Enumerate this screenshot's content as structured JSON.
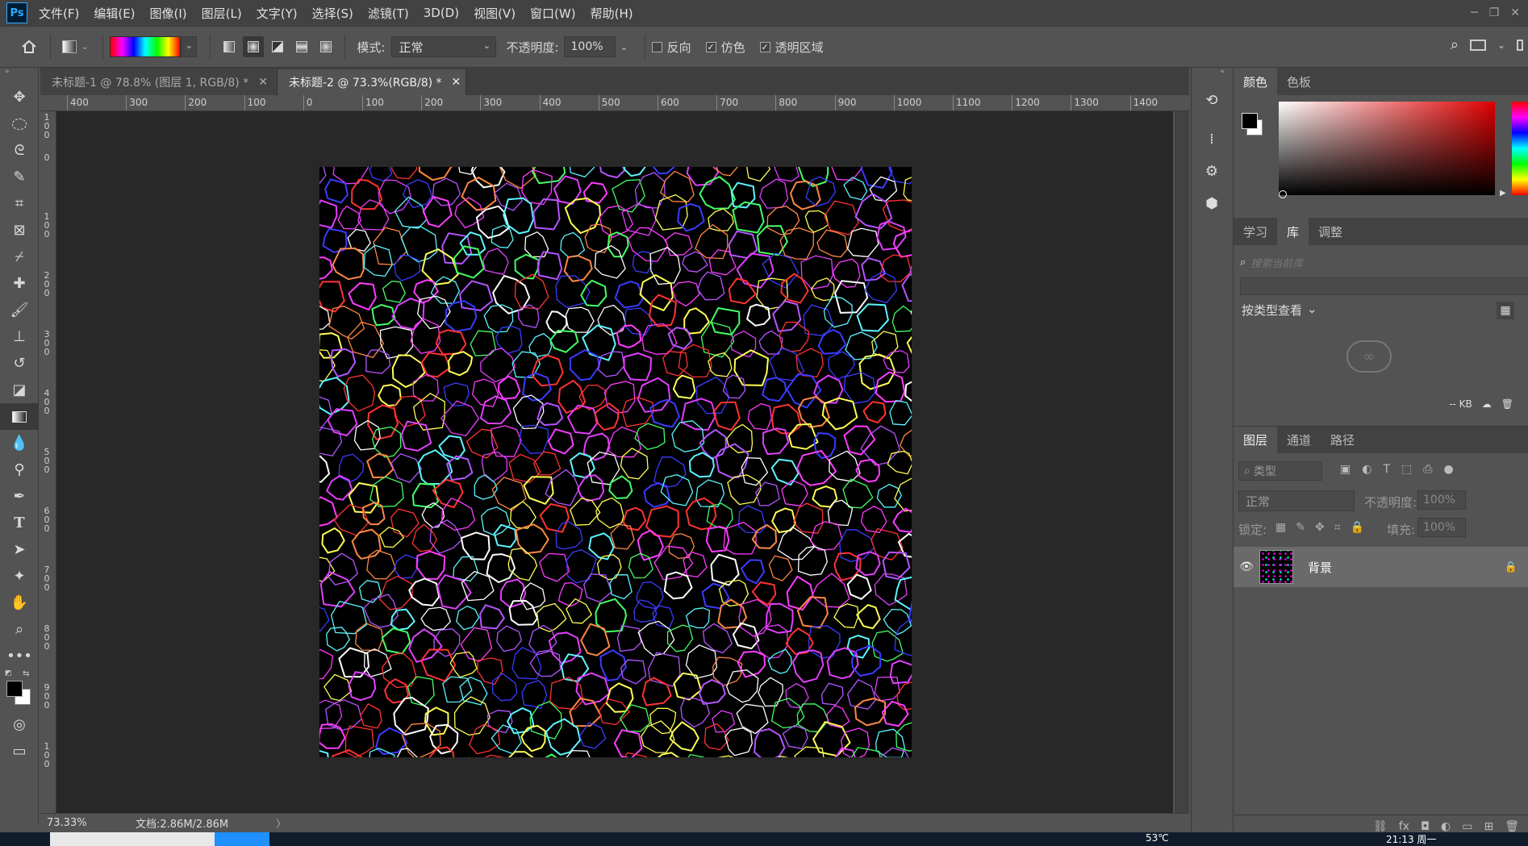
{
  "app": {
    "logo": "Ps"
  },
  "menu": [
    "文件(F)",
    "编辑(E)",
    "图像(I)",
    "图层(L)",
    "文字(Y)",
    "选择(S)",
    "滤镜(T)",
    "3D(D)",
    "视图(V)",
    "窗口(W)",
    "帮助(H)"
  ],
  "options": {
    "mode_label": "模式:",
    "mode_value": "正常",
    "opacity_label": "不透明度:",
    "opacity_value": "100%",
    "reverse_label": "反向",
    "dither_label": "仿色",
    "transparency_label": "透明区域",
    "reverse_checked": false,
    "dither_checked": true,
    "transparency_checked": true
  },
  "tabs": [
    {
      "label": "未标题-1 @ 78.8% (图层 1, RGB/8) *",
      "active": false
    },
    {
      "label": "未标题-2 @ 73.3%(RGB/8) *",
      "active": true
    }
  ],
  "ruler_top": [
    "400",
    "300",
    "200",
    "100",
    "0",
    "100",
    "200",
    "300",
    "400",
    "500",
    "600",
    "700",
    "800",
    "900",
    "1000",
    "1100",
    "1200",
    "1300",
    "1400"
  ],
  "ruler_left": [
    "1\n0\n0",
    "0",
    "1\n0\n0",
    "2\n0\n0",
    "3\n0\n0",
    "4\n0\n0",
    "5\n0\n0",
    "6\n0\n0",
    "7\n0\n0",
    "8\n0\n0",
    "9\n0\n0",
    "1\n0\n0"
  ],
  "status": {
    "zoom": "73.33%",
    "doc": "文档:2.86M/2.86M",
    "arrow": "〉"
  },
  "panels": {
    "color_tabs": [
      "颜色",
      "色板"
    ],
    "lib_tabs": [
      "学习",
      "库",
      "调整"
    ],
    "lib_search_placeholder": "搜索当前库",
    "lib_view": "按类型查看",
    "lib_size": "-- KB",
    "layer_tabs": [
      "图层",
      "通道",
      "路径"
    ],
    "layer_filter": "类型",
    "blend_mode": "正常",
    "opacity_label": "不透明度:",
    "opacity_value": "100%",
    "lock_label": "锁定:",
    "fill_label": "填充:",
    "fill_value": "100%",
    "layer_name": "背景"
  },
  "colors": {
    "foreground": "#000000",
    "background": "#ffffff",
    "accent": "#31a8ff"
  },
  "taskbar": {
    "temp": "53℃",
    "time": "21:13 周一"
  }
}
